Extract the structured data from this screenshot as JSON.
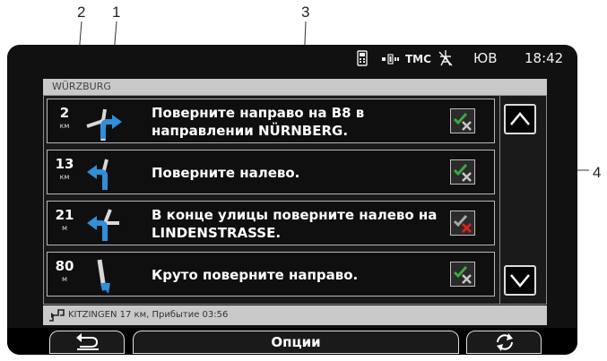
{
  "callouts": [
    "1",
    "2",
    "3",
    "4"
  ],
  "status_bar": {
    "tmc": "TMC",
    "direction": "ЮВ",
    "time": "18:42",
    "icons": [
      "phone-icon",
      "battery-icon",
      "gps-off-icon"
    ]
  },
  "route": {
    "destination": "WÜRZBURG",
    "info": "KITZINGEN 17 км, Прибытие 03:56"
  },
  "maneuvers": [
    {
      "distance": "2",
      "unit": "км",
      "instruction": "Поверните направо на B8 в направлении NÜRNBERG.",
      "icon": "turn-right-icon",
      "status": "enabled"
    },
    {
      "distance": "13",
      "unit": "км",
      "instruction": "Поверните налево.",
      "icon": "turn-left-icon",
      "status": "enabled"
    },
    {
      "distance": "21",
      "unit": "м",
      "instruction": "В конце улицы поверните налево на LINDENSTRASSE.",
      "icon": "t-junction-left-icon",
      "status": "excluded"
    },
    {
      "distance": "80",
      "unit": "м",
      "instruction": "Круто поверните направо.",
      "icon": "sharp-right-icon",
      "status": "enabled"
    }
  ],
  "bottom_bar": {
    "back_icon": "back-icon",
    "options_label": "Опции",
    "recalculate_icon": "recalculate-icon"
  },
  "colors": {
    "background": "#111111",
    "route_arrow": "#2f8fd8",
    "road": "#d8d8d8",
    "check_green": "#3ea83e",
    "cross_red": "#e0201c"
  }
}
